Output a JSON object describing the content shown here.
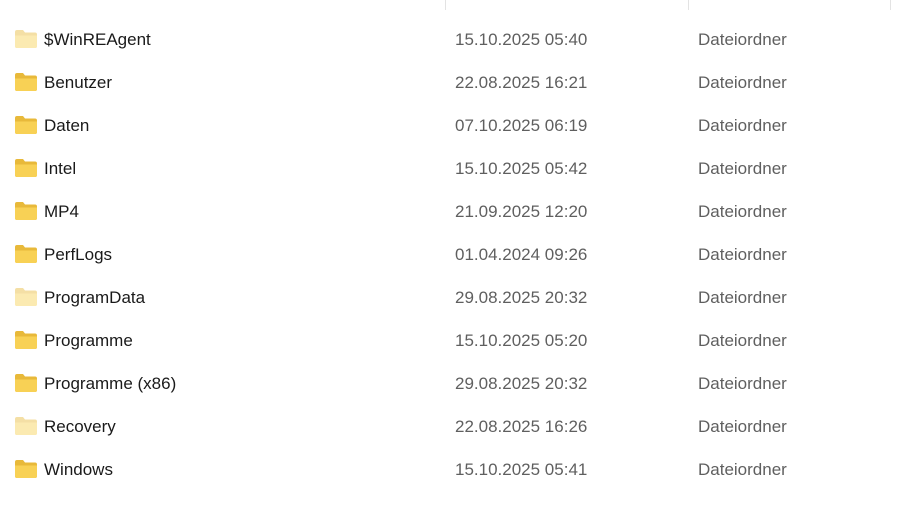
{
  "list": {
    "rows": [
      {
        "icon": "folder-icon",
        "hidden": true,
        "name": "$WinREAgent",
        "date": "15.10.2025 05:40",
        "type": "Dateiordner"
      },
      {
        "icon": "folder-icon",
        "hidden": false,
        "name": "Benutzer",
        "date": "22.08.2025 16:21",
        "type": "Dateiordner"
      },
      {
        "icon": "folder-icon",
        "hidden": false,
        "name": "Daten",
        "date": "07.10.2025 06:19",
        "type": "Dateiordner"
      },
      {
        "icon": "folder-icon",
        "hidden": false,
        "name": "Intel",
        "date": "15.10.2025 05:42",
        "type": "Dateiordner"
      },
      {
        "icon": "folder-icon",
        "hidden": false,
        "name": "MP4",
        "date": "21.09.2025 12:20",
        "type": "Dateiordner"
      },
      {
        "icon": "folder-icon",
        "hidden": false,
        "name": "PerfLogs",
        "date": "01.04.2024 09:26",
        "type": "Dateiordner"
      },
      {
        "icon": "folder-icon",
        "hidden": true,
        "name": "ProgramData",
        "date": "29.08.2025 20:32",
        "type": "Dateiordner"
      },
      {
        "icon": "folder-icon",
        "hidden": false,
        "name": "Programme",
        "date": "15.10.2025 05:20",
        "type": "Dateiordner"
      },
      {
        "icon": "folder-icon",
        "hidden": false,
        "name": "Programme (x86)",
        "date": "29.08.2025 20:32",
        "type": "Dateiordner"
      },
      {
        "icon": "folder-icon",
        "hidden": true,
        "name": "Recovery",
        "date": "22.08.2025 16:26",
        "type": "Dateiordner"
      },
      {
        "icon": "folder-icon",
        "hidden": false,
        "name": "Windows",
        "date": "15.10.2025 05:41",
        "type": "Dateiordner"
      }
    ]
  },
  "colors": {
    "folder_front": "#f8d155",
    "folder_back": "#e8b93a",
    "secondary_text": "#5f5f5f"
  }
}
